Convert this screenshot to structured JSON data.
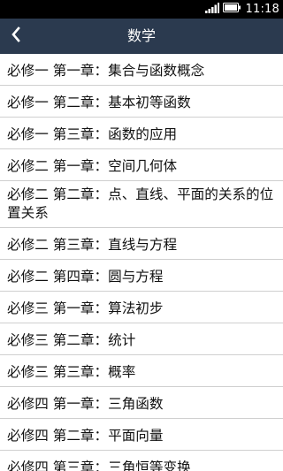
{
  "status_bar": {
    "time": "11:18",
    "icons": [
      "signal-icon",
      "battery-icon"
    ]
  },
  "header": {
    "title": "数学",
    "back_icon": "chevron-left-icon"
  },
  "colors": {
    "header_bg": "#2b3a4f",
    "status_bg": "#000000",
    "divider": "#cfcfcf"
  },
  "list": {
    "items": [
      {
        "label": "必修一 第一章：集合与函数概念"
      },
      {
        "label": "必修一 第二章：基本初等函数"
      },
      {
        "label": "必修一 第三章：函数的应用"
      },
      {
        "label": "必修二 第一章：空间几何体"
      },
      {
        "label": "必修二 第二章：点、直线、平面的关系的位置关系"
      },
      {
        "label": "必修二 第三章：直线与方程"
      },
      {
        "label": "必修二 第四章：圆与方程"
      },
      {
        "label": "必修三 第一章：算法初步"
      },
      {
        "label": "必修三 第二章：统计"
      },
      {
        "label": "必修三 第三章：概率"
      },
      {
        "label": "必修四 第一章：三角函数"
      },
      {
        "label": "必修四 第二章：平面向量"
      },
      {
        "label": "必修四 第三章：三角恒等变换"
      }
    ]
  }
}
